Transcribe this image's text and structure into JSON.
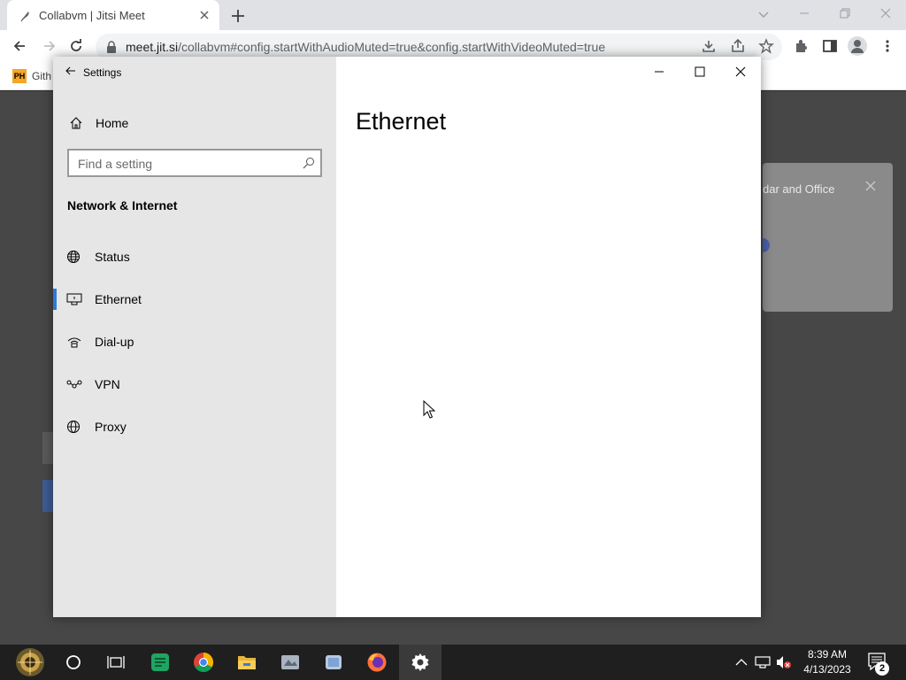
{
  "browser": {
    "tab_title": "Collabvm | Jitsi Meet",
    "url_host": "meet.jit.si",
    "url_rest": "/collabvm#config.startWithAudioMuted=true&config.startWithVideoMuted=true",
    "bookmark_icon_text": "PH",
    "bookmark_label": "Gith"
  },
  "page_behind": {
    "notification_text": "dar and Office"
  },
  "settings": {
    "window_title": "Settings",
    "home_label": "Home",
    "search_placeholder": "Find a setting",
    "section_title": "Network & Internet",
    "nav_items": [
      {
        "label": "Status",
        "icon": "status-globe-icon"
      },
      {
        "label": "Ethernet",
        "icon": "ethernet-icon",
        "active": true
      },
      {
        "label": "Dial-up",
        "icon": "dial-up-icon"
      },
      {
        "label": "VPN",
        "icon": "vpn-icon"
      },
      {
        "label": "Proxy",
        "icon": "globe-icon"
      }
    ],
    "content_title": "Ethernet",
    "accent_color": "#2b79d6"
  },
  "taskbar": {
    "time": "8:39 AM",
    "date": "4/13/2023",
    "notification_count": "2",
    "apps": [
      "start-icon",
      "cortana-icon",
      "task-view-icon",
      "sheets-icon",
      "chrome-icon",
      "file-explorer-icon",
      "app-icon",
      "paint-icon",
      "firefox-icon",
      "settings-icon"
    ]
  }
}
